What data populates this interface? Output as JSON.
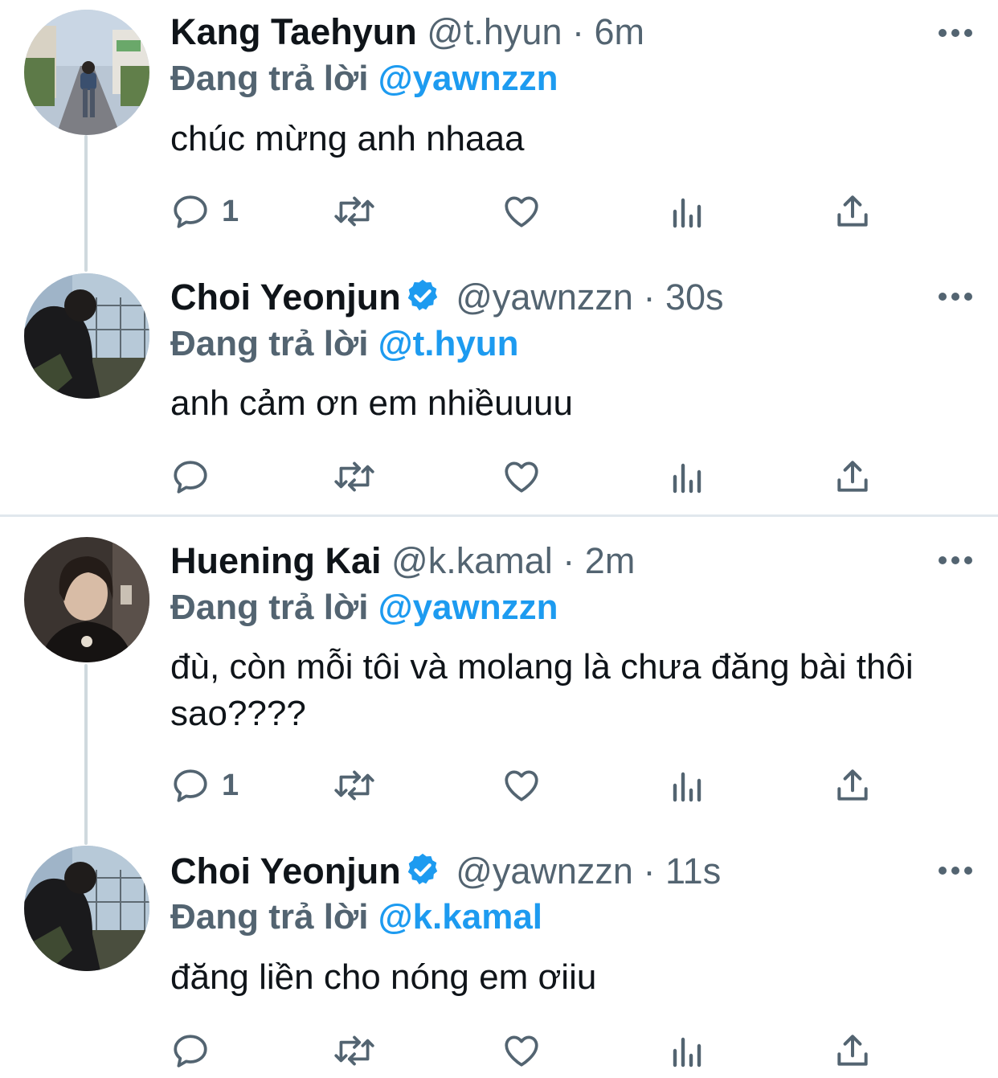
{
  "colors": {
    "accent": "#1d9bf0",
    "muted": "#536471",
    "text": "#0f1419",
    "thread_line": "#cfd9de",
    "separator": "#e1e8ed"
  },
  "threads": [
    {
      "tweets": [
        {
          "name": "Kang Taehyun",
          "handle": "@t.hyun",
          "dot": "·",
          "time": "6m",
          "verified": false,
          "reply_prefix": "Đang trả lời",
          "reply_mention": "@yawnzzn",
          "text": "chúc mừng anh nhaaa",
          "reply_count": "1"
        },
        {
          "name": "Choi Yeonjun",
          "handle": "@yawnzzn",
          "dot": "·",
          "time": "30s",
          "verified": true,
          "reply_prefix": "Đang trả lời",
          "reply_mention": "@t.hyun",
          "text": "anh cảm ơn em nhiềuuuu",
          "reply_count": ""
        }
      ]
    },
    {
      "tweets": [
        {
          "name": "Huening Kai",
          "handle": "@k.kamal",
          "dot": "·",
          "time": "2m",
          "verified": false,
          "reply_prefix": "Đang trả lời",
          "reply_mention": "@yawnzzn",
          "text": "đù, còn mỗi tôi và molang là chưa đăng bài thôi sao????",
          "reply_count": "1"
        },
        {
          "name": "Choi Yeonjun",
          "handle": "@yawnzzn",
          "dot": "·",
          "time": "11s",
          "verified": true,
          "reply_prefix": "Đang trả lời",
          "reply_mention": "@k.kamal",
          "text": "đăng liền cho nóng em ơiiu",
          "reply_count": ""
        }
      ]
    }
  ]
}
